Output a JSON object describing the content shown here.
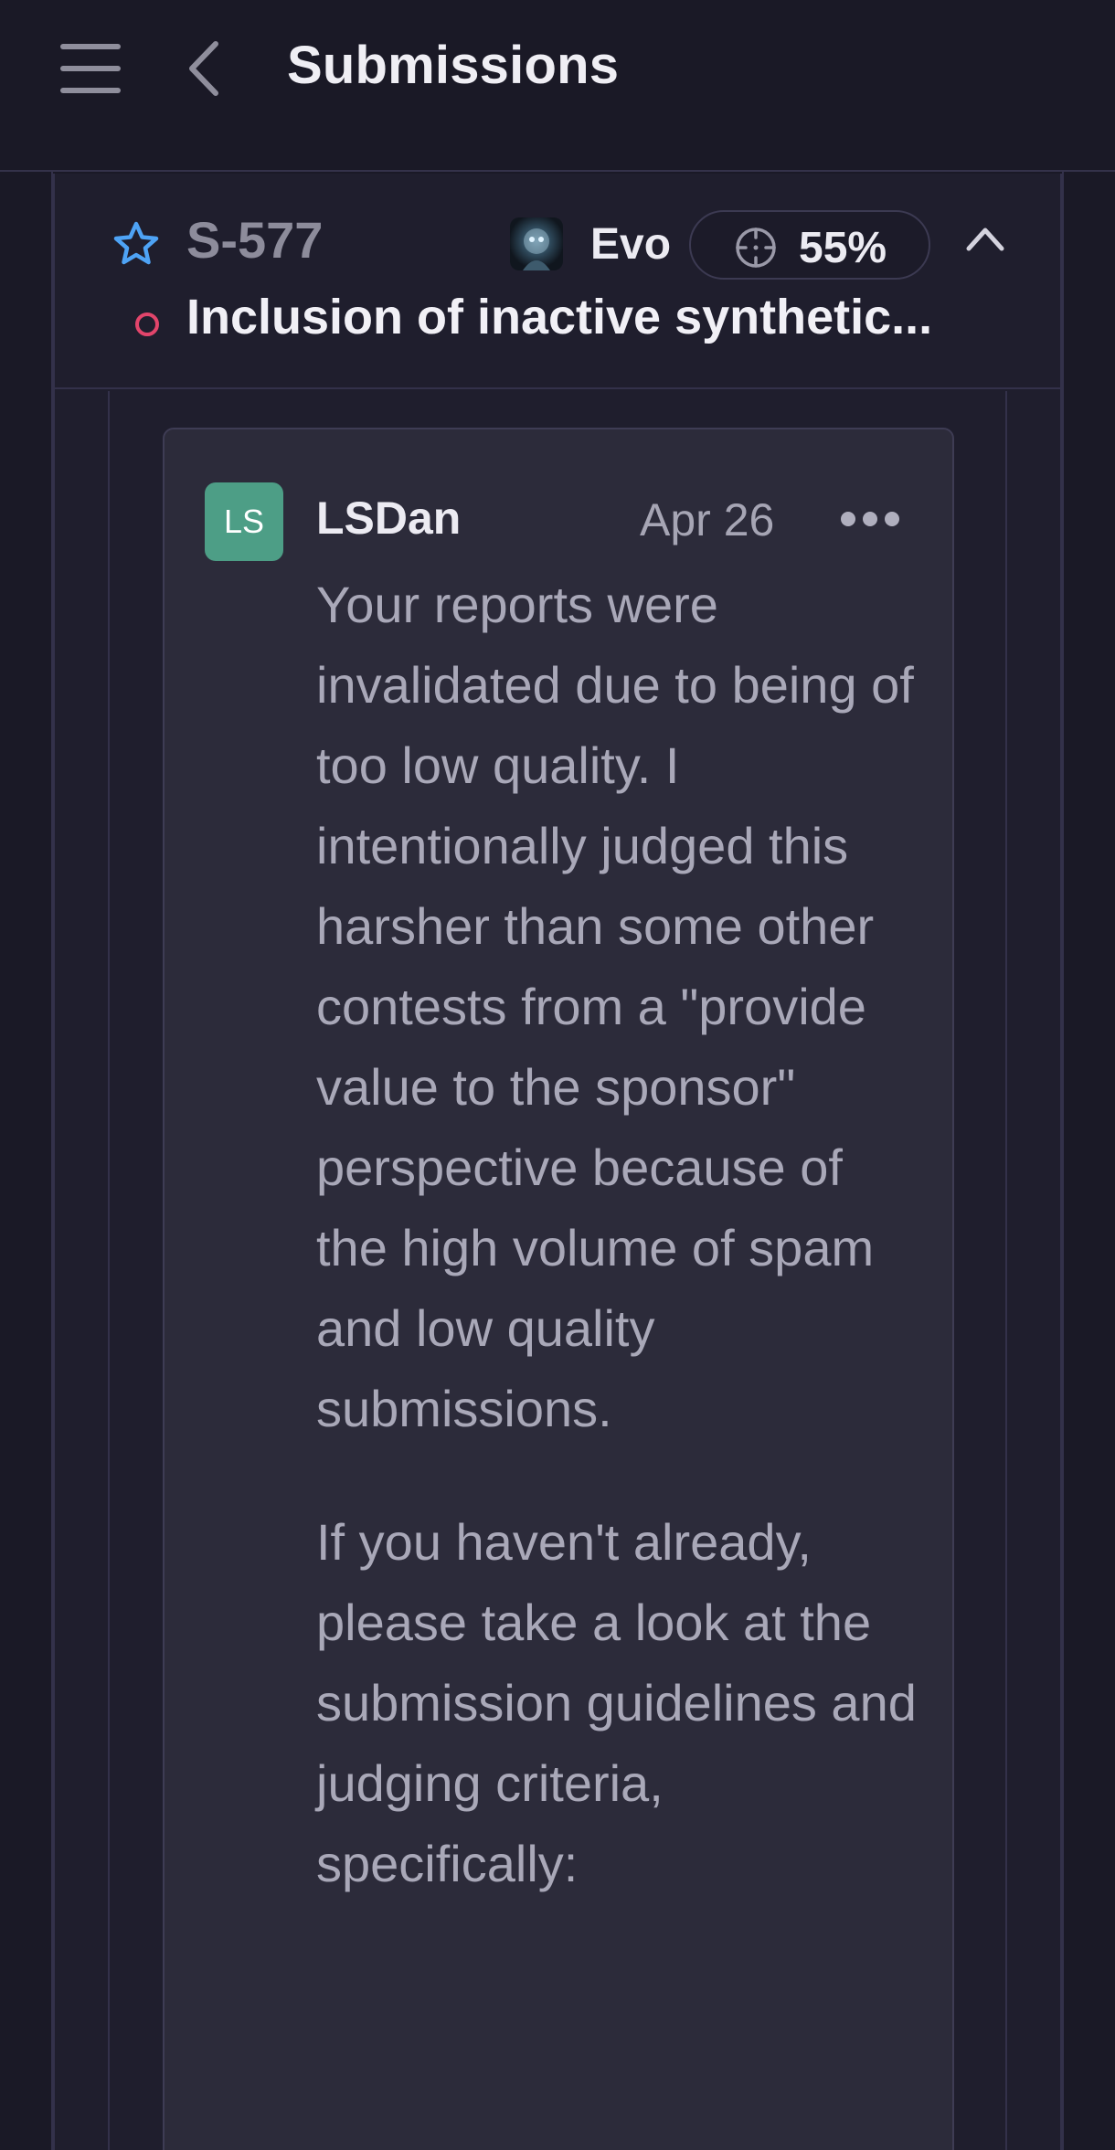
{
  "header": {
    "title": "Submissions"
  },
  "submission": {
    "id": "S-577",
    "author": "Evo",
    "score": "55%",
    "title": "Inclusion of inactive synthetic...",
    "colors": {
      "star": "#4ea3f5",
      "status": "#e2456b"
    }
  },
  "comment": {
    "avatar_initials": "LS",
    "avatar_color": "#4d9e86",
    "author": "LSDan",
    "date": "Apr 26",
    "paragraphs": [
      "Your reports were invalidated due to being of too low quality. I intentionally judged this harsher than some other contests from a \"provide value to the sponsor\" perspective because of the high volume of spam and low quality submissions.",
      "If you haven't already, please take a look at the submission guidelines and judging criteria, specifically:"
    ]
  },
  "icons": {
    "menu": "hamburger-icon",
    "back": "chevron-left-icon",
    "star": "star-outline-icon",
    "score": "crosshair-icon",
    "collapse": "chevron-up-icon",
    "more": "more-horizontal-icon"
  }
}
